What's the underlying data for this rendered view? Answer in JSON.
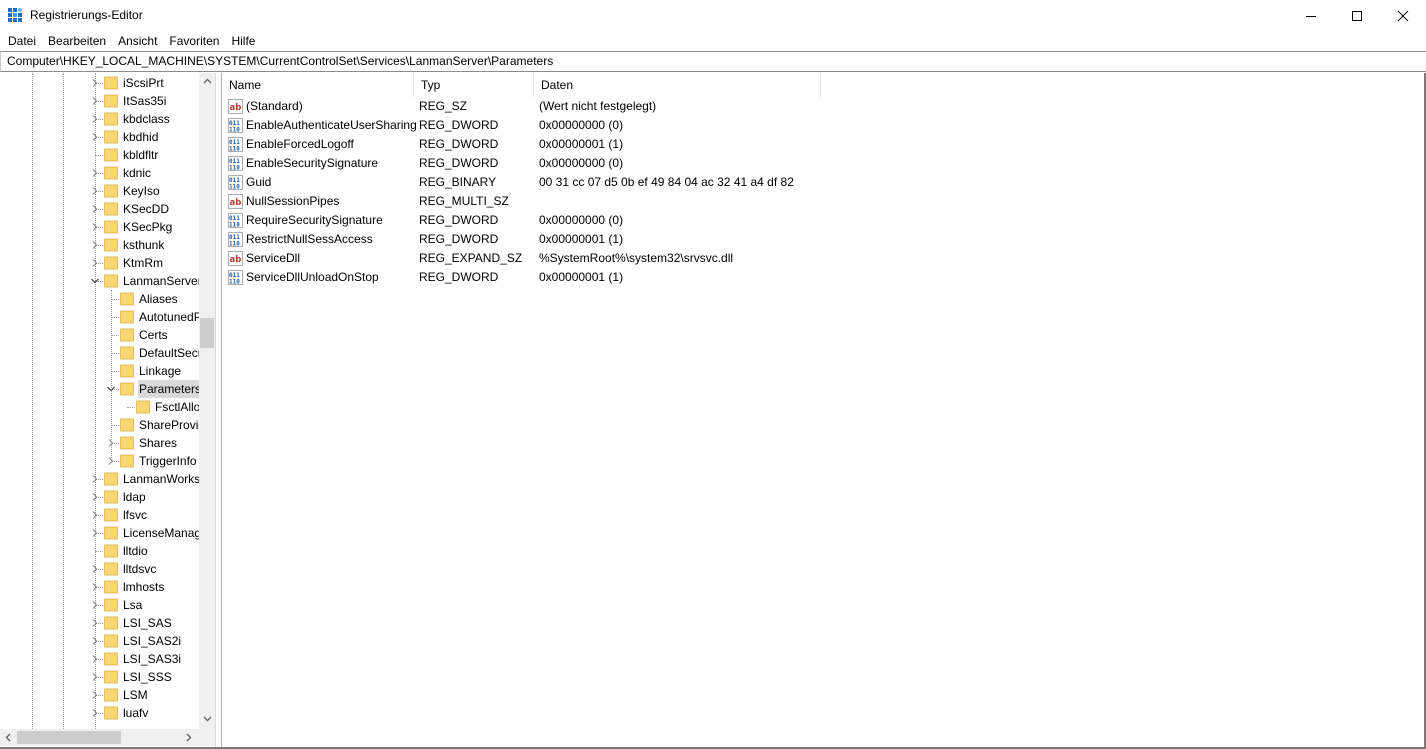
{
  "window": {
    "title": "Registrierungs-Editor",
    "icon": "regedit-icon"
  },
  "menu": [
    "Datei",
    "Bearbeiten",
    "Ansicht",
    "Favoriten",
    "Hilfe"
  ],
  "address": "Computer\\HKEY_LOCAL_MACHINE\\SYSTEM\\CurrentControlSet\\Services\\LanmanServer\\Parameters",
  "tree": {
    "items": [
      {
        "label": "iScsiPrt",
        "level": 1,
        "expander": "collapsed"
      },
      {
        "label": "ItSas35i",
        "level": 1,
        "expander": "collapsed"
      },
      {
        "label": "kbdclass",
        "level": 1,
        "expander": "collapsed"
      },
      {
        "label": "kbdhid",
        "level": 1,
        "expander": "collapsed"
      },
      {
        "label": "kbldfltr",
        "level": 1,
        "expander": "none"
      },
      {
        "label": "kdnic",
        "level": 1,
        "expander": "collapsed"
      },
      {
        "label": "KeyIso",
        "level": 1,
        "expander": "collapsed"
      },
      {
        "label": "KSecDD",
        "level": 1,
        "expander": "collapsed"
      },
      {
        "label": "KSecPkg",
        "level": 1,
        "expander": "collapsed"
      },
      {
        "label": "ksthunk",
        "level": 1,
        "expander": "collapsed"
      },
      {
        "label": "KtmRm",
        "level": 1,
        "expander": "collapsed"
      },
      {
        "label": "LanmanServer",
        "level": 1,
        "expander": "expanded"
      },
      {
        "label": "Aliases",
        "level": 2,
        "expander": "none"
      },
      {
        "label": "AutotunedParameters",
        "level": 2,
        "expander": "none"
      },
      {
        "label": "Certs",
        "level": 2,
        "expander": "none"
      },
      {
        "label": "DefaultSecurity",
        "level": 2,
        "expander": "none"
      },
      {
        "label": "Linkage",
        "level": 2,
        "expander": "none"
      },
      {
        "label": "Parameters",
        "level": 2,
        "expander": "expanded",
        "selected": true
      },
      {
        "label": "FsctlAllowlist",
        "level": 3,
        "expander": "none"
      },
      {
        "label": "ShareProviders",
        "level": 2,
        "expander": "none"
      },
      {
        "label": "Shares",
        "level": 2,
        "expander": "collapsed"
      },
      {
        "label": "TriggerInfo",
        "level": 2,
        "expander": "collapsed"
      },
      {
        "label": "LanmanWorkstation",
        "level": 1,
        "expander": "collapsed"
      },
      {
        "label": "ldap",
        "level": 1,
        "expander": "collapsed"
      },
      {
        "label": "lfsvc",
        "level": 1,
        "expander": "collapsed"
      },
      {
        "label": "LicenseManager",
        "level": 1,
        "expander": "collapsed"
      },
      {
        "label": "lltdio",
        "level": 1,
        "expander": "none"
      },
      {
        "label": "lltdsvc",
        "level": 1,
        "expander": "collapsed"
      },
      {
        "label": "lmhosts",
        "level": 1,
        "expander": "collapsed"
      },
      {
        "label": "Lsa",
        "level": 1,
        "expander": "collapsed"
      },
      {
        "label": "LSI_SAS",
        "level": 1,
        "expander": "collapsed"
      },
      {
        "label": "LSI_SAS2i",
        "level": 1,
        "expander": "collapsed"
      },
      {
        "label": "LSI_SAS3i",
        "level": 1,
        "expander": "collapsed"
      },
      {
        "label": "LSI_SSS",
        "level": 1,
        "expander": "collapsed"
      },
      {
        "label": "LSM",
        "level": 1,
        "expander": "collapsed"
      },
      {
        "label": "luafv",
        "level": 1,
        "expander": "collapsed"
      }
    ]
  },
  "list": {
    "columns": [
      "Name",
      "Typ",
      "Daten"
    ],
    "rows": [
      {
        "name": "(Standard)",
        "type": "REG_SZ",
        "data": "(Wert nicht festgelegt)",
        "icon": "string-value-icon"
      },
      {
        "name": "EnableAuthenticateUserSharing",
        "type": "REG_DWORD",
        "data": "0x00000000 (0)",
        "icon": "binary-value-icon"
      },
      {
        "name": "EnableForcedLogoff",
        "type": "REG_DWORD",
        "data": "0x00000001 (1)",
        "icon": "binary-value-icon"
      },
      {
        "name": "EnableSecuritySignature",
        "type": "REG_DWORD",
        "data": "0x00000000 (0)",
        "icon": "binary-value-icon"
      },
      {
        "name": "Guid",
        "type": "REG_BINARY",
        "data": "00 31 cc 07 d5 0b ef 49 84 04 ac 32 41 a4 df 82",
        "icon": "binary-value-icon"
      },
      {
        "name": "NullSessionPipes",
        "type": "REG_MULTI_SZ",
        "data": "",
        "icon": "string-value-icon"
      },
      {
        "name": "RequireSecuritySignature",
        "type": "REG_DWORD",
        "data": "0x00000000 (0)",
        "icon": "binary-value-icon"
      },
      {
        "name": "RestrictNullSessAccess",
        "type": "REG_DWORD",
        "data": "0x00000001 (1)",
        "icon": "binary-value-icon"
      },
      {
        "name": "ServiceDll",
        "type": "REG_EXPAND_SZ",
        "data": "%SystemRoot%\\system32\\srvsvc.dll",
        "icon": "string-value-icon"
      },
      {
        "name": "ServiceDllUnloadOnStop",
        "type": "REG_DWORD",
        "data": "0x00000001 (1)",
        "icon": "binary-value-icon"
      }
    ]
  },
  "colors": {
    "folder": "#f8d775",
    "folder_dark": "#e0b04a",
    "selection": "#d9d9d9",
    "string_icon": "#c0392b",
    "binary_icon": "#1f5fa8"
  }
}
